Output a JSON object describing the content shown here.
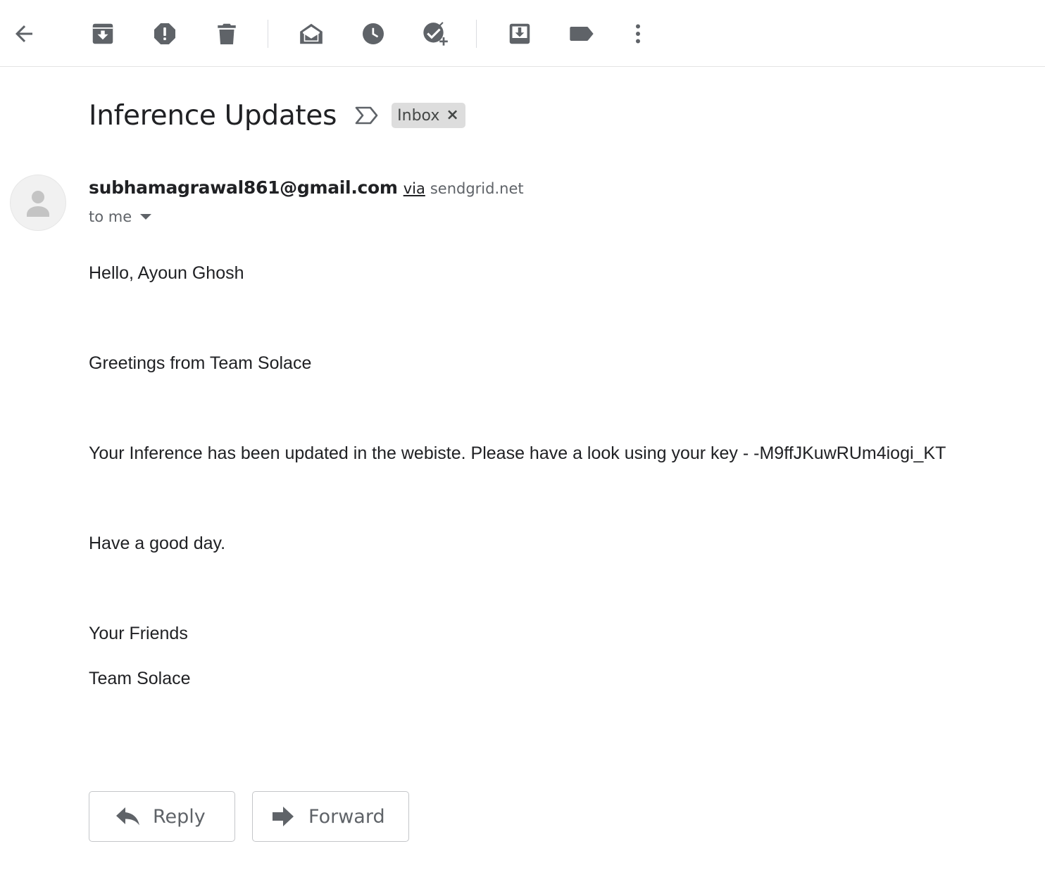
{
  "toolbar": {
    "icons": [
      "back-arrow-icon",
      "archive-icon",
      "report-spam-icon",
      "delete-icon",
      "mark-unread-icon",
      "snooze-icon",
      "add-to-tasks-icon",
      "move-to-icon",
      "label-icon",
      "more-options-icon"
    ]
  },
  "email": {
    "subject": "Inference Updates",
    "label": "Inbox",
    "label_close": "×",
    "sender": {
      "email": "subhamagrawal861@gmail.com",
      "via": "via",
      "via_domain": "sendgrid.net"
    },
    "recipient": "to me",
    "body": {
      "greeting": "Hello, Ayoun Ghosh",
      "intro": "Greetings from Team Solace",
      "message": "Your Inference has been updated in the webiste. Please have a look using your key - -M9ffJKuwRUm4iogi_KT",
      "closing": "Have a good day.",
      "signoff": "Your Friends",
      "signature": "Team Solace"
    }
  },
  "actions": {
    "reply_label": "Reply",
    "forward_label": "Forward"
  },
  "colors": {
    "icon": "#5f6368",
    "label_chip_bg": "#dddddd",
    "text": "#202124",
    "secondary_text": "#5f6368",
    "border": "#c4c6c9"
  }
}
